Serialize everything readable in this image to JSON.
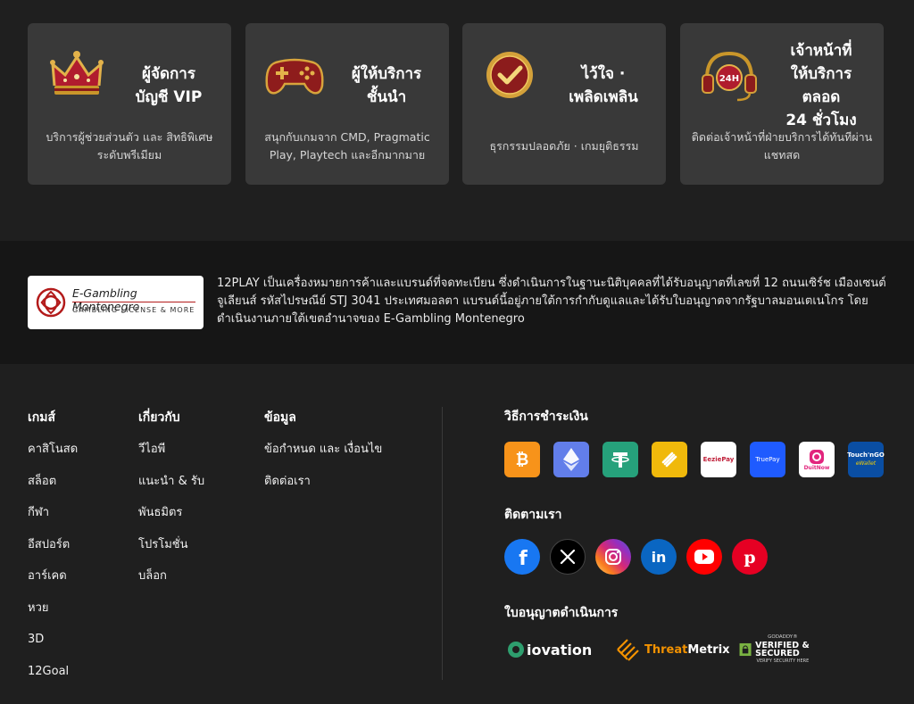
{
  "features": [
    {
      "icon": "crown-icon",
      "title": "ผู้จัดการ\nบัญชี VIP",
      "desc": "บริการผู้ช่วยส่วนตัว และ สิทธิพิเศษระดับพรีเมียม"
    },
    {
      "icon": "gamepad-icon",
      "title": "ผู้ให้บริการ\nชั้นนำ",
      "desc": "สนุกกับเกมจาก CMD, Pragmatic Play, Playtech และอีกมากมาย"
    },
    {
      "icon": "check-badge-icon",
      "title": "ไว้ใจ ·\nเพลิดเพลิน",
      "desc": "ธุรกรรมปลอดภัย · เกมยุติธรรม"
    },
    {
      "icon": "headset-24h-icon",
      "title": "เจ้าหน้าที่\nให้บริการ\nตลอด\n24 ชั่วโมง",
      "desc": "ติดต่อเจ้าหน้าที่ฝ่ายบริการได้ทันทีผ่านแชทสด"
    }
  ],
  "license": {
    "logo_name": "E-Gambling Montenegro",
    "logo_sub": "GAMBLING LICENSE & MORE",
    "text": "12PLAY เป็นเครื่องหมายการค้าและแบรนด์ที่จดทะเบียน ซึ่งดำเนินการในฐานะนิติบุคคลที่ได้รับอนุญาตที่เลขที่ 12 ถนนเซิร์ช เมืองเซนต์จูเลียนส์ รหัสไปรษณีย์ STJ 3041 ประเทศมอลตา แบรนด์นี้อยู่ภายใต้การกำกับดูแลและได้รับใบอนุญาตจากรัฐบาลมอนเตเนโกร โดยดำเนินงานภายใต้เขตอำนาจของ E-Gambling Montenegro"
  },
  "footer": {
    "columns": [
      {
        "title": "เกมส์",
        "links": [
          "คาสิโนสด",
          "สล็อต",
          "กีฬา",
          "อีสปอร์ต",
          "อาร์เคด",
          "หวย",
          "3D",
          "12Goal"
        ]
      },
      {
        "title": "เกี่ยวกับ",
        "links": [
          "วีไอพี",
          "แนะนำ & รับ",
          "พันธมิตร",
          "โปรโมชั่น",
          "บล็อก"
        ]
      },
      {
        "title": "ข้อมูล",
        "links": [
          "ข้อกำหนด และ เงื่อนไข",
          "ติดต่อเรา"
        ]
      }
    ],
    "payment_title": "วิธีการชำระเงิน",
    "payments": [
      {
        "name": "bitcoin-icon",
        "color": "#f7931a"
      },
      {
        "name": "ethereum-icon",
        "color": "#627eea"
      },
      {
        "name": "tether-icon",
        "color": "#26a17b"
      },
      {
        "name": "binance-icon",
        "color": "#f0b90b"
      },
      {
        "name": "eeziepay-icon",
        "color": "#ffffff",
        "label": "EeziePay"
      },
      {
        "name": "truepay-icon",
        "color": "#1f5bff",
        "label": "TruePay"
      },
      {
        "name": "duitnow-icon",
        "color": "#ffffff",
        "label": "DuitNow"
      },
      {
        "name": "touchngo-icon",
        "color": "#0a4ea3",
        "label": "Touch'nGO",
        "sub": "eWallet"
      }
    ],
    "social_title": "ติดตามเรา",
    "socials": [
      {
        "name": "facebook-icon",
        "color": "#1877f2"
      },
      {
        "name": "x-icon",
        "color": "#000000"
      },
      {
        "name": "instagram-icon",
        "color": "#d62976"
      },
      {
        "name": "linkedin-icon",
        "color": "#0a66c2"
      },
      {
        "name": "youtube-icon",
        "color": "#ff0000"
      },
      {
        "name": "pinterest-icon",
        "color": "#e60023"
      }
    ],
    "license_title": "ใบอนุญาตดำเนินการ",
    "licenses": {
      "iovation": "iovation",
      "threatmetrix_a": "Threat",
      "threatmetrix_b": "Metrix",
      "godaddy_top": "GODADDY®",
      "godaddy_main": "VERIFIED & SECURED",
      "godaddy_sub": "VERIFY SECURITY HERE"
    }
  }
}
